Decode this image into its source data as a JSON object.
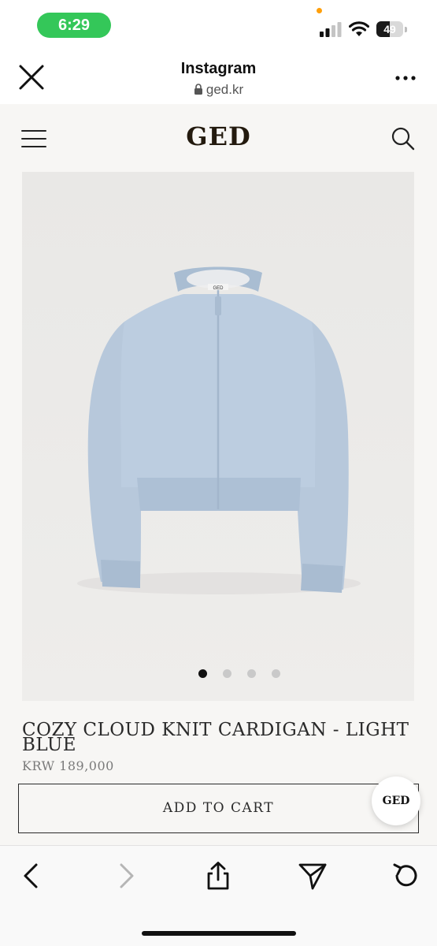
{
  "status_bar": {
    "time": "6:29",
    "battery_level": "49",
    "battery_fraction": 0.49,
    "time_pill_color": "#34c759"
  },
  "browser_header": {
    "title": "Instagram",
    "url": "ged.kr",
    "icons": [
      "close-icon",
      "lock-icon",
      "more-icon"
    ]
  },
  "site": {
    "brand": "GED",
    "icons": [
      "hamburger-menu-icon",
      "search-icon"
    ],
    "product": {
      "title": "COZY CLOUD KNIT CARDIGAN - LIGHT BLUE",
      "price": "KRW 189,000",
      "image_label": "GED",
      "image_count": 4,
      "active_image_index": 0,
      "cart_label": "ADD TO CART"
    },
    "chat_bubble_label": "GED",
    "colors": {
      "background": "#f7f6f4",
      "image_background": "#eeedeb",
      "cardigan": "#b8c9dc",
      "text": "#2a2a2a"
    }
  },
  "toolbar": {
    "icons": [
      "back-arrow-icon",
      "forward-arrow-icon",
      "share-icon",
      "send-icon",
      "reload-icon"
    ],
    "forward_enabled": false
  }
}
